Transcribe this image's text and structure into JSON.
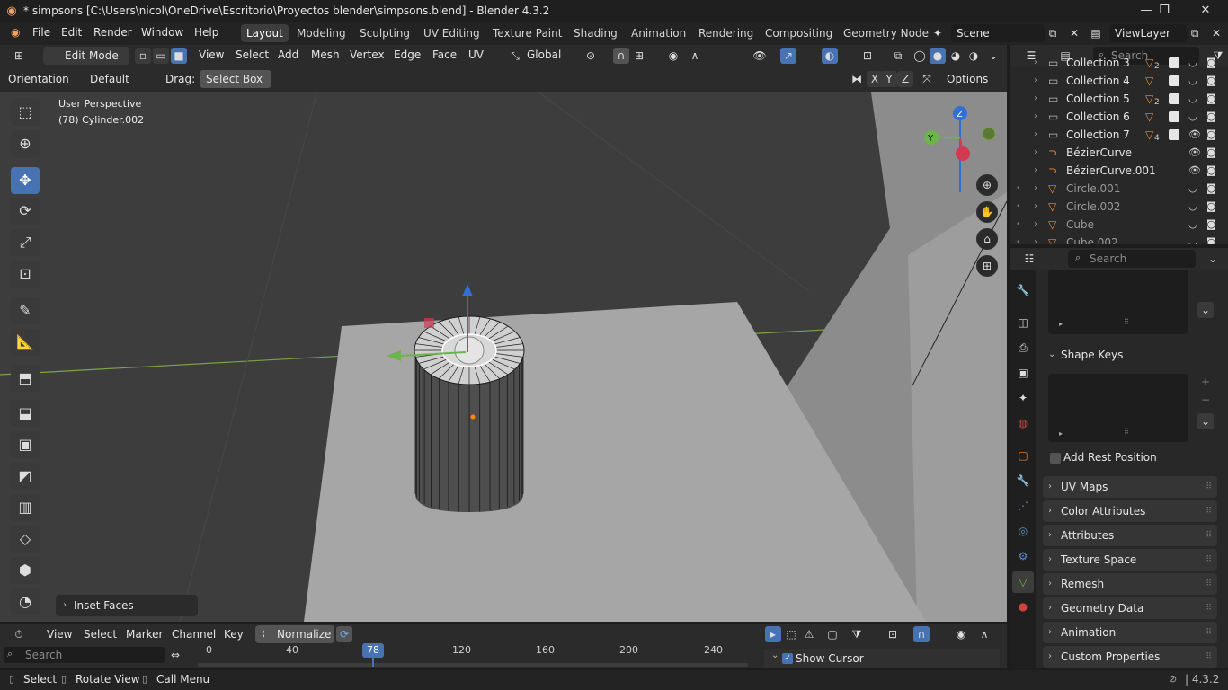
{
  "window": {
    "title": "* simpsons [C:\\Users\\nicol\\OneDrive\\Escritorio\\Proyectos blender\\simpsons.blend] - Blender 4.3.2",
    "minimize": "—",
    "maximize": "❐",
    "close": "✕"
  },
  "menu": {
    "file": "File",
    "edit": "Edit",
    "render": "Render",
    "window": "Window",
    "help": "Help"
  },
  "workspaces": [
    "Layout",
    "Modeling",
    "Sculpting",
    "UV Editing",
    "Texture Paint",
    "Shading",
    "Animation",
    "Rendering",
    "Compositing",
    "Geometry Node"
  ],
  "active_workspace": "Layout",
  "scene": {
    "name": "Scene",
    "view_layer": "ViewLayer"
  },
  "viewport_header": {
    "mode": "Edit Mode",
    "menus": [
      "View",
      "Select",
      "Add",
      "Mesh",
      "Vertex",
      "Edge",
      "Face",
      "UV"
    ],
    "transform_orientation": "Global"
  },
  "tool_settings": {
    "orientation_label": "Orientation:",
    "orientation_value": "Default",
    "drag_label": "Drag:",
    "drag_value": "Select Box",
    "axes": [
      "X",
      "Y",
      "Z"
    ],
    "options": "Options"
  },
  "viewport": {
    "perspective": "User Perspective",
    "object": "(78) Cylinder.002",
    "operator_panel": "Inset Faces",
    "gizmo": {
      "x": "X",
      "y": "Y",
      "z": "Z"
    }
  },
  "outliner": {
    "search_placeholder": "Search",
    "rows": [
      {
        "name": "Collection 3",
        "badge": "2"
      },
      {
        "name": "Collection 4",
        "badge": ""
      },
      {
        "name": "Collection 5",
        "badge": "2"
      },
      {
        "name": "Collection 6",
        "badge": ""
      },
      {
        "name": "Collection 7",
        "badge": "4"
      },
      {
        "name": "BézierCurve",
        "badge": ""
      },
      {
        "name": "BézierCurve.001",
        "badge": ""
      },
      {
        "name": "Circle.001",
        "badge": ""
      },
      {
        "name": "Circle.002",
        "badge": ""
      },
      {
        "name": "Cube",
        "badge": ""
      },
      {
        "name": "Cube.002",
        "badge": ""
      }
    ]
  },
  "properties": {
    "search_placeholder": "Search",
    "shape_keys": "Shape Keys",
    "add_rest_position": "Add Rest Position",
    "panels": [
      "UV Maps",
      "Color Attributes",
      "Attributes",
      "Texture Space",
      "Remesh",
      "Geometry Data",
      "Animation",
      "Custom Properties"
    ]
  },
  "timeline": {
    "menus": [
      "View",
      "Select",
      "Marker",
      "Channel",
      "Key"
    ],
    "normalize": "Normalize",
    "search_placeholder": "Search",
    "current_frame": "78",
    "ticks": [
      "0",
      "40",
      "120",
      "160",
      "200",
      "240"
    ],
    "show_cursor": "Show Cursor"
  },
  "statusbar": {
    "select": "Select",
    "rotate": "Rotate View",
    "call_menu": "Call Menu",
    "version": "4.3.2"
  },
  "colors": {
    "accent": "#4772b3",
    "viewport": "#3d3d3d",
    "plane": "#a6a6a6",
    "grid_green": "#7aa34a"
  }
}
